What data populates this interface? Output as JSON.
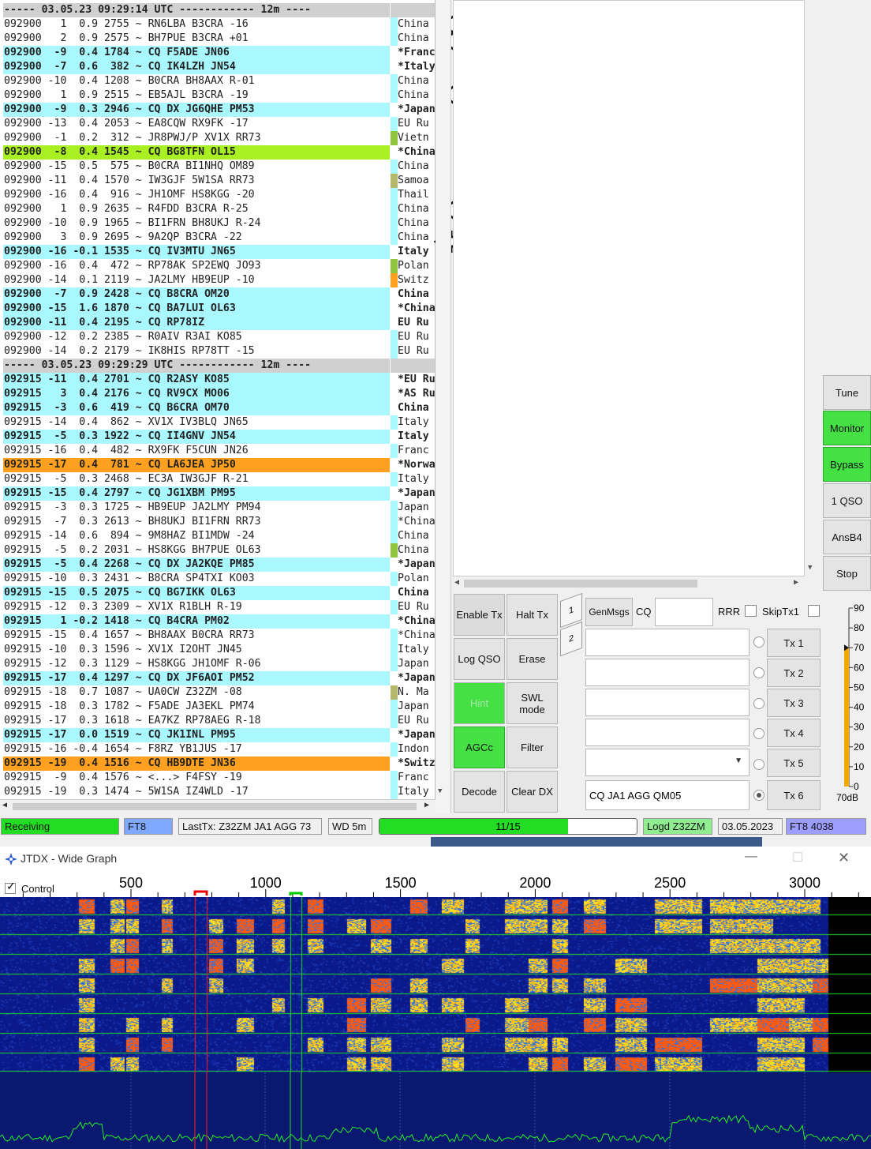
{
  "decode_rows": [
    {
      "t": "sep",
      "msg": "----- 03.05.23 09:29:14 UTC ------------ 12m ----",
      "ctry": ""
    },
    {
      "t": "n",
      "msg": "092900   1  0.9 2755 ~ RN6LBA B3CRA -16",
      "ctry": "China"
    },
    {
      "t": "n",
      "msg": "092900   2  0.9 2575 ~ BH7PUE B3CRA +01",
      "ctry": "China"
    },
    {
      "t": "cq",
      "msg": "092900  -9  0.4 1784 ~ CQ F5ADE JN06",
      "ctry": "*Franc",
      "hl": true
    },
    {
      "t": "cq",
      "msg": "092900  -7  0.6  382 ~ CQ IK4LZH JN54",
      "ctry": "*Italy",
      "hl": true
    },
    {
      "t": "n",
      "msg": "092900 -10  0.4 1208 ~ B0CRA BH8AAX R-01",
      "ctry": "China"
    },
    {
      "t": "n",
      "msg": "092900   1  0.9 2515 ~ EB5AJL B3CRA -19",
      "ctry": "China"
    },
    {
      "t": "cq",
      "msg": "092900  -9  0.3 2946 ~ CQ DX JG6QHE PM53",
      "ctry": "*Japan",
      "hl": true
    },
    {
      "t": "n",
      "msg": "092900 -13  0.4 2053 ~ EA8CQW RX9FK -17",
      "ctry": "EU Ru"
    },
    {
      "t": "n",
      "msg": "092900  -1  0.2  312 ~ JR8PWJ/P XV1X RR73",
      "ctry": "Vietn",
      "mark": "#8ec63f"
    },
    {
      "t": "green",
      "msg": "092900  -8  0.4 1545 ~ CQ BG8TFN OL15",
      "ctry": "*China",
      "hl": true
    },
    {
      "t": "n",
      "msg": "092900 -15  0.5  575 ~ B0CRA BI1NHQ OM89",
      "ctry": "China"
    },
    {
      "t": "n",
      "msg": "092900 -11  0.4 1570 ~ IW3GJF 5W1SA RR73",
      "ctry": "Samoa",
      "mark": "#b5b86a"
    },
    {
      "t": "n",
      "msg": "092900 -16  0.4  916 ~ JH1OMF HS8KGG -20",
      "ctry": "Thail"
    },
    {
      "t": "n",
      "msg": "092900   1  0.9 2635 ~ R4FDD B3CRA R-25",
      "ctry": "China"
    },
    {
      "t": "n",
      "msg": "092900 -10  0.9 1965 ~ BI1FRN BH8UKJ R-24",
      "ctry": "China"
    },
    {
      "t": "n",
      "msg": "092900   3  0.9 2695 ~ 9A2QP B3CRA -22",
      "ctry": "China"
    },
    {
      "t": "cq",
      "msg": "092900 -16 -0.1 1535 ~ CQ IV3MTU JN65",
      "ctry": "Italy",
      "hl": true
    },
    {
      "t": "n",
      "msg": "092900 -16  0.4  472 ~ RP78AK SP2EWQ JO93",
      "ctry": "Polan",
      "mark": "#8ec63f"
    },
    {
      "t": "n",
      "msg": "092900 -14  0.1 2119 ~ JA2LMY HB9EUP -10",
      "ctry": "Switz",
      "mark": "#ffa020"
    },
    {
      "t": "cq",
      "msg": "092900  -7  0.9 2428 ~ CQ B8CRA OM20",
      "ctry": "China",
      "hl": true
    },
    {
      "t": "cq",
      "msg": "092900 -15  1.6 1870 ~ CQ BA7LUI OL63",
      "ctry": "*China",
      "hl": true
    },
    {
      "t": "cq",
      "msg": "092900 -11  0.4 2195 ~ CQ RP78IZ",
      "ctry": "EU Ru",
      "hl": true
    },
    {
      "t": "n",
      "msg": "092900 -12  0.2 2385 ~ R0AIV R3AI KO85",
      "ctry": "EU Ru"
    },
    {
      "t": "n",
      "msg": "092900 -14  0.2 2179 ~ IK8HIS RP78TT -15",
      "ctry": "EU Ru"
    },
    {
      "t": "sep",
      "msg": "----- 03.05.23 09:29:29 UTC ------------ 12m ----",
      "ctry": ""
    },
    {
      "t": "cq",
      "msg": "092915 -11  0.4 2701 ~ CQ R2ASY KO85",
      "ctry": "*EU Ru",
      "hl": true
    },
    {
      "t": "cq",
      "msg": "092915   3  0.4 2176 ~ CQ RV9CX MO06",
      "ctry": "*AS Ru",
      "hl": true
    },
    {
      "t": "cq",
      "msg": "092915  -3  0.6  419 ~ CQ B6CRA OM70",
      "ctry": "China",
      "hl": true
    },
    {
      "t": "n",
      "msg": "092915 -14  0.4  862 ~ XV1X IV3BLQ JN65",
      "ctry": "Italy"
    },
    {
      "t": "cq",
      "msg": "092915  -5  0.3 1922 ~ CQ II4GNV JN54",
      "ctry": "Italy",
      "hl": true
    },
    {
      "t": "n",
      "msg": "092915 -16  0.4  482 ~ RX9FK F5CUN JN26",
      "ctry": "Franc"
    },
    {
      "t": "orange",
      "msg": "092915 -17  0.4  781 ~ CQ LA6JEA JP50",
      "ctry": "*Norwa",
      "hl": true
    },
    {
      "t": "n",
      "msg": "092915  -5  0.3 2468 ~ EC3A IW3GJF R-21",
      "ctry": "Italy"
    },
    {
      "t": "cq",
      "msg": "092915 -15  0.4 2797 ~ CQ JG1XBM PM95",
      "ctry": "*Japan",
      "hl": true
    },
    {
      "t": "n",
      "msg": "092915  -3  0.3 1725 ~ HB9EUP JA2LMY PM94",
      "ctry": "Japan"
    },
    {
      "t": "n",
      "msg": "092915  -7  0.3 2613 ~ BH8UKJ BI1FRN RR73",
      "ctry": "*China"
    },
    {
      "t": "n",
      "msg": "092915 -14  0.6  894 ~ 9M8HAZ BI1MDW -24",
      "ctry": "China"
    },
    {
      "t": "n",
      "msg": "092915  -5  0.2 2031 ~ HS8KGG BH7PUE OL63",
      "ctry": "China",
      "mark": "#8ec63f"
    },
    {
      "t": "cq",
      "msg": "092915  -5  0.4 2268 ~ CQ DX JA2KQE PM85",
      "ctry": "*Japan",
      "hl": true
    },
    {
      "t": "n",
      "msg": "092915 -10  0.3 2431 ~ B8CRA SP4TXI KO03",
      "ctry": "Polan"
    },
    {
      "t": "cq",
      "msg": "092915 -15  0.5 2075 ~ CQ BG7IKK OL63",
      "ctry": "China",
      "hl": true
    },
    {
      "t": "n",
      "msg": "092915 -12  0.3 2309 ~ XV1X R1BLH R-19",
      "ctry": "EU Ru"
    },
    {
      "t": "cq",
      "msg": "092915   1 -0.2 1418 ~ CQ B4CRA PM02",
      "ctry": "*China",
      "hl": true
    },
    {
      "t": "n",
      "msg": "092915 -15  0.4 1657 ~ BH8AAX B0CRA RR73",
      "ctry": "*China"
    },
    {
      "t": "n",
      "msg": "092915 -10  0.3 1596 ~ XV1X I2OHT JN45",
      "ctry": "Italy"
    },
    {
      "t": "n",
      "msg": "092915 -12  0.3 1129 ~ HS8KGG JH1OMF R-06",
      "ctry": "Japan"
    },
    {
      "t": "cq",
      "msg": "092915 -17  0.4 1297 ~ CQ DX JF6AOI PM52",
      "ctry": "*Japan",
      "hl": true
    },
    {
      "t": "n",
      "msg": "092915 -18  0.7 1087 ~ UA0CW Z32ZM -08",
      "ctry": "N. Ma",
      "mark": "#b5b86a"
    },
    {
      "t": "n",
      "msg": "092915 -18  0.3 1782 ~ F5ADE JA3EKL PM74",
      "ctry": "Japan"
    },
    {
      "t": "n",
      "msg": "092915 -17  0.3 1618 ~ EA7KZ RP78AEG R-18",
      "ctry": "EU Ru"
    },
    {
      "t": "cq",
      "msg": "092915 -17  0.0 1519 ~ CQ JK1INL PM95",
      "ctry": "*Japan",
      "hl": true
    },
    {
      "t": "n",
      "msg": "092915 -16 -0.4 1654 ~ F8RZ YB1JUS -17",
      "ctry": "Indon"
    },
    {
      "t": "orange",
      "msg": "092915 -19  0.4 1516 ~ CQ HB9DTE JN36",
      "ctry": "*Switz",
      "hl": true
    },
    {
      "t": "n",
      "msg": "092915  -9  0.4 1576 ~ <...> F4FSY -19",
      "ctry": "Franc"
    },
    {
      "t": "n",
      "msg": "092915 -19  0.3 1474 ~ 5W1SA IZ4WLD -17",
      "ctry": "Italy"
    }
  ],
  "side_buttons": {
    "tune": "Tune",
    "monitor": "Monitor",
    "bypass": "Bypass",
    "one_qso": "1 QSO",
    "ansb4": "AnsB4",
    "stop": "Stop"
  },
  "controls": {
    "enable_tx": "Enable Tx",
    "halt_tx": "Halt Tx",
    "log_qso": "Log QSO",
    "erase": "Erase",
    "hint": "Hint",
    "swl_mode": "SWL mode",
    "agcc": "AGCc",
    "filter": "Filter",
    "decode": "Decode",
    "clear_dx": "Clear DX",
    "tab1": "1",
    "tab2": "2",
    "genmsgs": "GenMsgs",
    "cq_label": "CQ",
    "rrr_label": "RRR",
    "skiptx1_label": "SkipTx1",
    "tx1": "Tx 1",
    "tx2": "Tx 2",
    "tx3": "Tx 3",
    "tx4": "Tx 4",
    "tx5": "Tx 5",
    "tx6": "Tx 6",
    "tx6_msg": "CQ  JA1 AGG QM05"
  },
  "meter": {
    "ticks": [
      "90",
      "80",
      "70",
      "60",
      "50",
      "40",
      "30",
      "20",
      "10",
      "0"
    ],
    "level_db": 70,
    "label": "70dB"
  },
  "status": {
    "receiving": "Receiving",
    "mode": "FT8",
    "last_tx": "LastTx: Z32ZM  JA1 AGG 73",
    "wd": "WD 5m",
    "progress_text": "11/15",
    "progress": 0.733,
    "logd": "Logd Z32ZM",
    "date": "03.05.2023",
    "mode2": "FT8  4038"
  },
  "wide_graph": {
    "title": "JTDX - Wide Graph",
    "control_label": "Control",
    "freq_ticks": [
      "500",
      "1000",
      "1500",
      "2000",
      "2500",
      "3000"
    ]
  },
  "colors": {
    "cq_bg": "#aaf8ff",
    "new_bg": "#a8f022",
    "priority_bg": "#ffa020",
    "green_btn": "#44e044"
  }
}
